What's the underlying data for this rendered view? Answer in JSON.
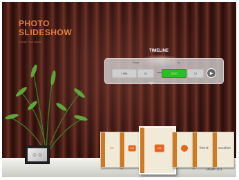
{
  "header": {
    "title_line1": "PHOTO",
    "title_line2": "SLIDESHOW",
    "subtitle": "Create Your Album"
  },
  "timeline": {
    "label": "TIMELINE",
    "from_label": "From",
    "to_label": "To",
    "from_year": "1986",
    "from_month": "01",
    "to_year": "2010",
    "to_month": "12",
    "play_icon": "play-icon"
  },
  "albums": [
    {
      "name": "album-1",
      "icon": "camera-icon",
      "title": ""
    },
    {
      "name": "album-2",
      "icon": "picture-icon",
      "title": ""
    },
    {
      "name": "album-3",
      "icon": "picture-icon",
      "title": ""
    },
    {
      "name": "album-4",
      "icon": "circle-icon",
      "title": ""
    },
    {
      "name": "album-5",
      "icon": "",
      "title": "friend"
    },
    {
      "name": "album-6",
      "icon": "",
      "title": "vacation"
    }
  ],
  "footer": {
    "album_counter": "Album: 3/11"
  },
  "colors": {
    "accent": "#e6661f",
    "active_green": "#2bbd2b"
  }
}
